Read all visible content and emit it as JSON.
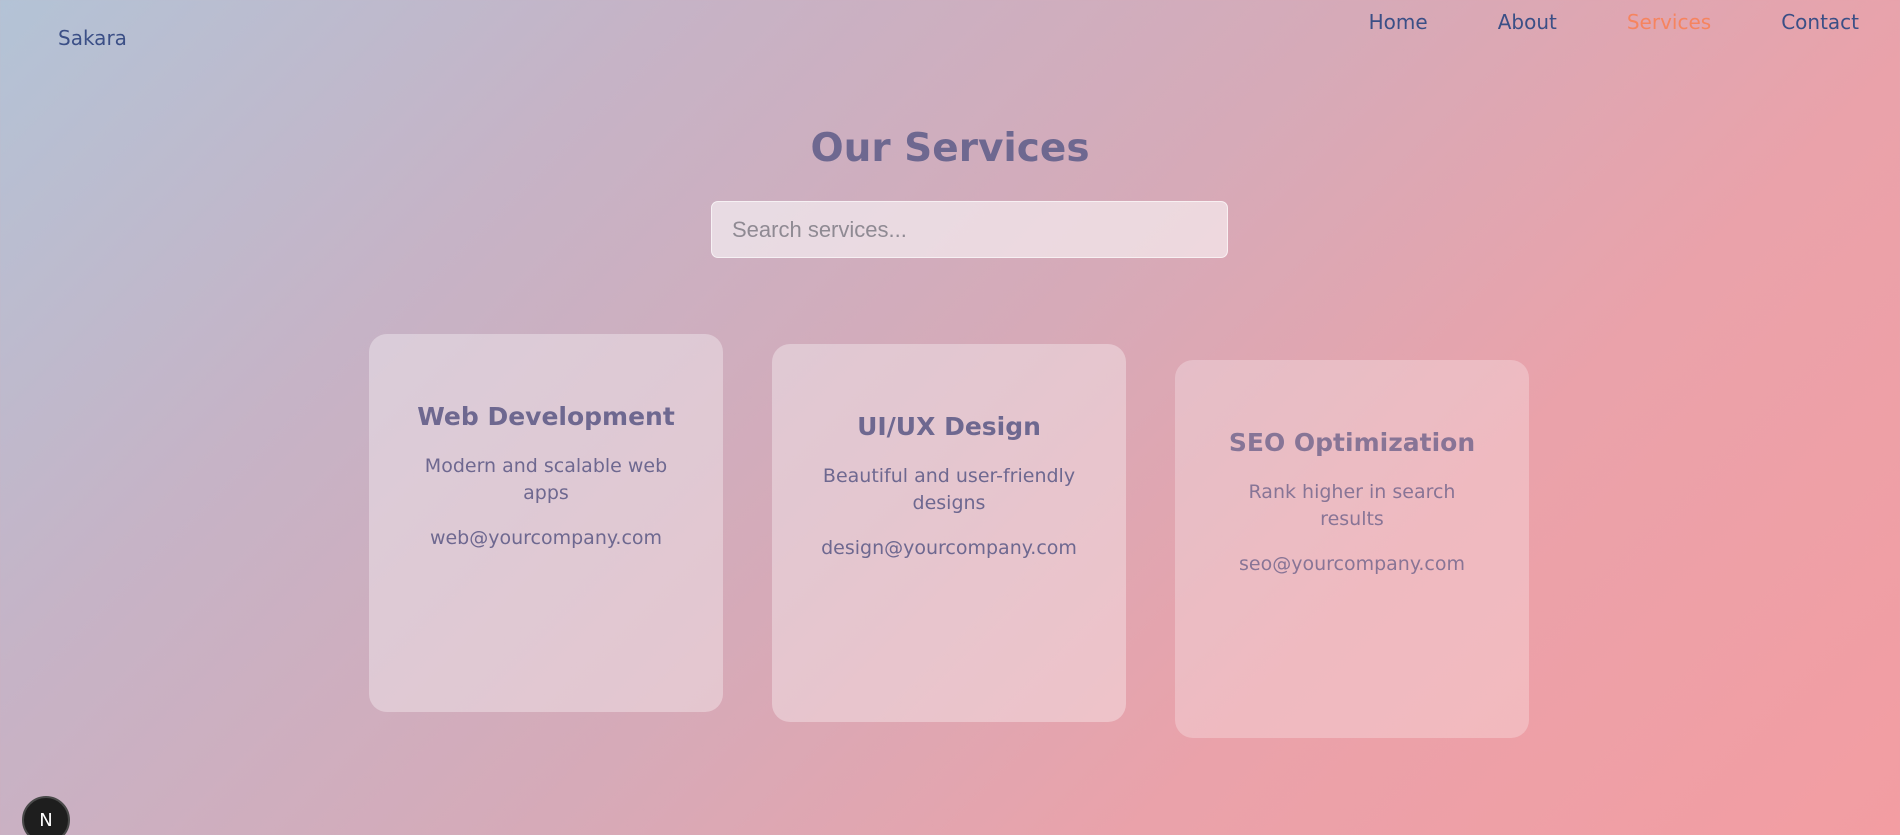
{
  "header": {
    "brand": "Sakara",
    "nav": [
      {
        "label": "Home",
        "active": false
      },
      {
        "label": "About",
        "active": false
      },
      {
        "label": "Services",
        "active": true
      },
      {
        "label": "Contact",
        "active": false
      }
    ]
  },
  "main": {
    "title": "Our Services",
    "search": {
      "placeholder": "Search services...",
      "value": ""
    },
    "cards": [
      {
        "title": "Web Development",
        "description": "Modern and scalable web apps",
        "email": "web@yourcompany.com"
      },
      {
        "title": "UI/UX Design",
        "description": "Beautiful and user-friendly designs",
        "email": "design@yourcompany.com"
      },
      {
        "title": "SEO Optimization",
        "description": "Rank higher in search results",
        "email": "seo@yourcompany.com"
      }
    ]
  },
  "badge": {
    "letter": "N"
  },
  "colors": {
    "brand_text": "#3b4f86",
    "active_nav": "#f6845f",
    "title_text": "#6e6890"
  }
}
